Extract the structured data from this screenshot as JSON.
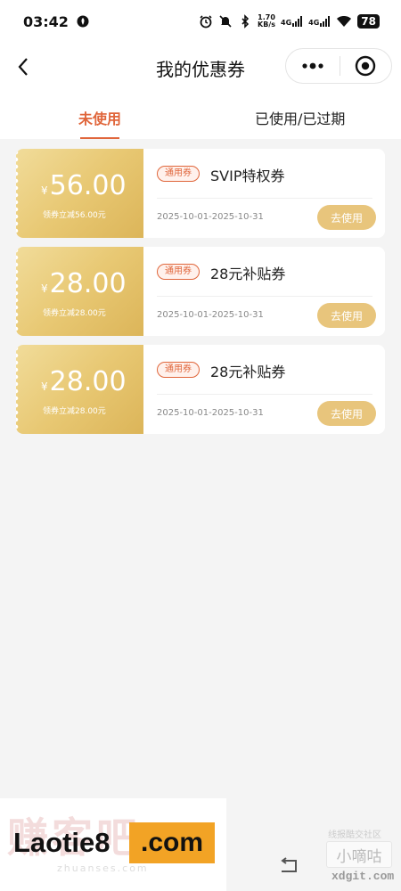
{
  "status_bar": {
    "time": "03:42",
    "net_speed_value": "1.70",
    "net_speed_unit": "KB/s",
    "signal1_label": "4G",
    "signal2_label": "4G",
    "battery": "78"
  },
  "nav": {
    "title": "我的优惠券",
    "more_glyph": "•••"
  },
  "tabs": [
    {
      "label": "未使用",
      "active": true
    },
    {
      "label": "已使用/已过期",
      "active": false
    }
  ],
  "coupons": [
    {
      "currency": "¥",
      "amount": "56.00",
      "desc": "领券立减56.00元",
      "tag": "通用券",
      "name": "SVIP特权券",
      "date": "2025-10-01-2025-10-31",
      "button": "去使用"
    },
    {
      "currency": "¥",
      "amount": "28.00",
      "desc": "领券立减28.00元",
      "tag": "通用券",
      "name": "28元补贴券",
      "date": "2025-10-01-2025-10-31",
      "button": "去使用"
    },
    {
      "currency": "¥",
      "amount": "28.00",
      "desc": "领券立减28.00元",
      "tag": "通用券",
      "name": "28元补贴券",
      "date": "2025-10-01-2025-10-31",
      "button": "去使用"
    }
  ],
  "watermarks": {
    "faint_text": "赚客吧",
    "faint_sub": "zhuanses.com",
    "laotie": "Laotie8",
    "com": ".com",
    "community_label": "线报酷交社区",
    "xiaodigu": "小嘀咕",
    "site": "xdgit.com"
  },
  "colors": {
    "accent": "#e0663b",
    "coupon_gold": "#e8c873",
    "button_gold": "#e8c57c",
    "page_bg": "#f4f4f4"
  }
}
